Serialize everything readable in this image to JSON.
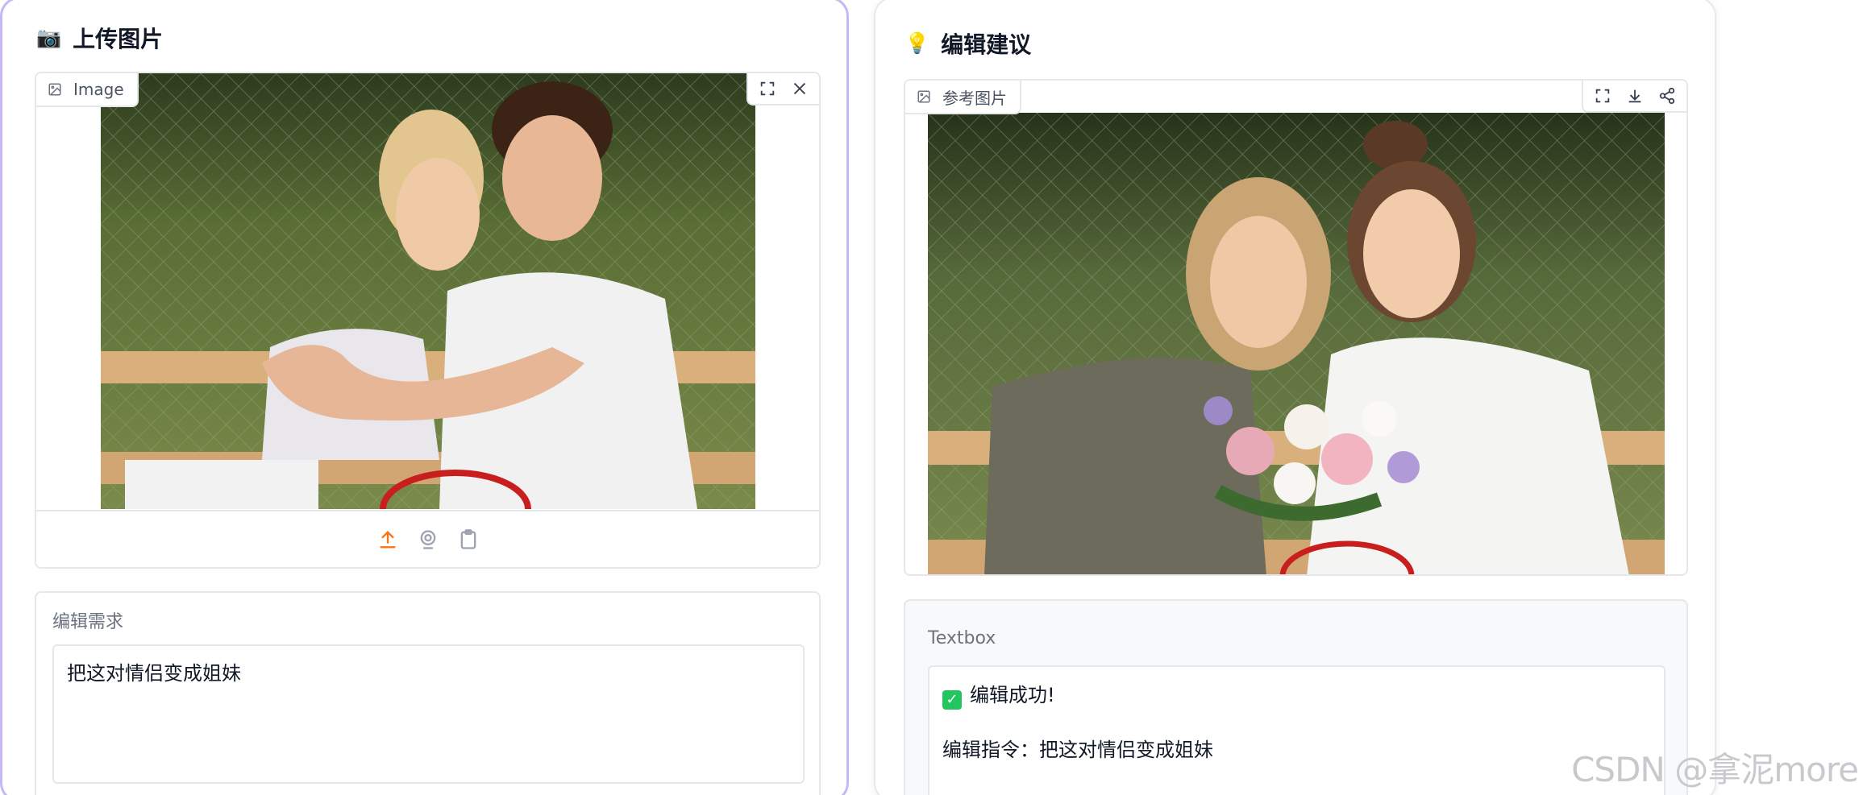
{
  "upload_panel": {
    "emoji": "📷",
    "title": "上传图片",
    "image_label": "Image",
    "form_label": "编辑需求",
    "textarea_value": "把这对情侣变成姐妹"
  },
  "suggest_panel": {
    "emoji": "💡",
    "title": "编辑建议",
    "image_label": "参考图片",
    "form_label": "Textbox",
    "result_line1": "编辑成功!",
    "result_line2": "编辑指令：把这对情侣变成姐妹"
  },
  "watermark": "CSDN @拿泥more",
  "colors": {
    "upload_accent": "#f97316",
    "left_border": "#c7b8f5",
    "success": "#22c55e"
  },
  "icons": [
    "camera-icon",
    "lightbulb-icon",
    "image-icon",
    "fullscreen-icon",
    "close-icon",
    "download-icon",
    "share-icon",
    "upload-icon",
    "webcam-icon",
    "clipboard-icon",
    "check-icon"
  ]
}
